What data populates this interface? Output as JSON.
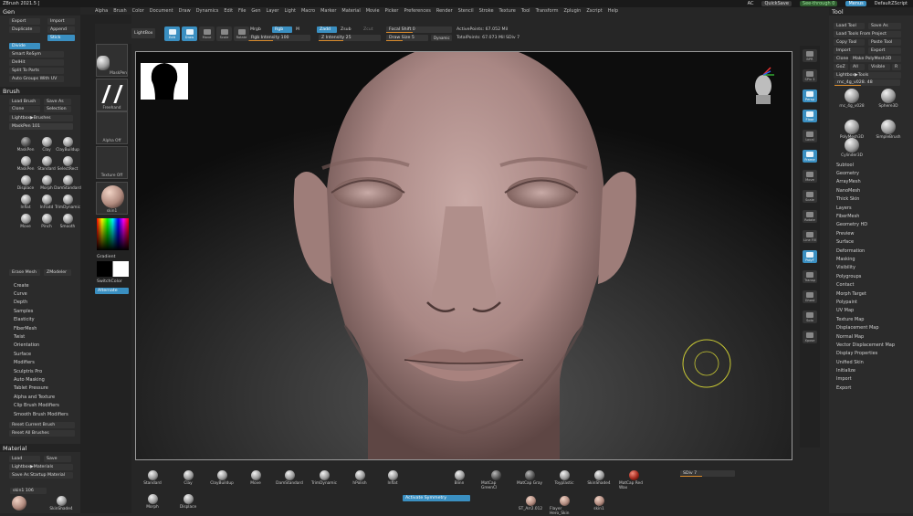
{
  "window_title": "ZBrush 2021.5 [",
  "title_right": {
    "ac": "AC",
    "quicksave": "QuickSave",
    "see_through": "See-through  0",
    "menus": "Menus",
    "script": "DefaultZScript"
  },
  "menubar": [
    "Alpha",
    "Brush",
    "Color",
    "Document",
    "Draw",
    "Dynamics",
    "Edit",
    "File",
    "Gen",
    "Layer",
    "Light",
    "Macro",
    "Marker",
    "Material",
    "Movie",
    "Picker",
    "Preferences",
    "Render",
    "Stencil",
    "Stroke",
    "Texture",
    "Tool",
    "Transform",
    "Zplugin",
    "Zscript",
    "Help"
  ],
  "left": {
    "gen_header": "Gen",
    "gen_buttons": [
      "Export",
      "Import",
      "Duplicate",
      "Append",
      "Stick",
      "Divide",
      "Smart ReSym",
      "DelHit",
      "Split To Parts",
      "Auto Groups With UV"
    ],
    "brush_header": "Brush",
    "brush_buttons": [
      "Load Brush",
      "Save As",
      "Clone",
      "Selection",
      "Lightbox▶Brushes",
      "MaskPen  101"
    ],
    "brushes": [
      "MaskPen",
      "Clay",
      "ClayBuildup",
      "MaskPen",
      "Standard",
      "SelectRect",
      "Displace",
      "Morph",
      "DamStandard",
      "Inflat",
      "InFlatd",
      "TrimDynamic",
      "Move",
      "Pinch",
      "Smooth",
      "Erase Mesh",
      "ZModeler"
    ],
    "bottom_row": [
      "Erase Mesh",
      "ZModeler"
    ],
    "brush_menu": [
      "Create",
      "Curve",
      "Depth",
      "Samples",
      "Elasticity",
      "FiberMesh",
      "Twist",
      "Orientation",
      "Surface",
      "Modifiers",
      "Sculptris Pro",
      "Auto Masking",
      "Tablet Pressure",
      "Alpha and Texture",
      "Clip Brush Modifiers",
      "Smooth Brush Modifiers"
    ],
    "reset_buttons": [
      "Reset Current Brush",
      "Reset All Brushes"
    ],
    "material_header": "Material",
    "material_buttons": [
      "Load",
      "Save",
      "Lightbox▶Materials",
      "Save As Startup Material"
    ],
    "material_name": "skin1  106",
    "material_thumbs": [
      "",
      "SkinShade4"
    ]
  },
  "shelf": {
    "projection_master": "Projection Master",
    "lightbox": "LightBox",
    "items": [
      "MaskPen",
      "Freehand",
      "Alpha Off",
      "Texture Off",
      "skin1"
    ],
    "gradient": "Gradient",
    "switch_color": "SwitchColor",
    "alternate": "Alternate"
  },
  "topbar": {
    "modes": [
      "Edit",
      "Draw",
      "Move",
      "Scale",
      "Rotate"
    ],
    "mrgb": "Mrgb",
    "rgb": "Rgb",
    "m": "M",
    "rgb_intensity": "Rgb Intensity  100",
    "zadd": "Zadd",
    "zsub": "Zsub",
    "zcut": "Zcut",
    "z_intensity": "Z Intensity  25",
    "focal_shift": "Focal Shift  0",
    "draw_size": "Draw Size  5",
    "dynamic": "Dynamic",
    "active_points": "ActivePoints: 67.052 Mil",
    "total_points": "TotalPoints: 67.073 Mil",
    "divide": "SDiv 7",
    "nav": "MENU"
  },
  "right_tool_strip": [
    "BPR",
    "SPix 3",
    "Persp",
    "Floor",
    "Local",
    "Frame",
    "Move",
    "Scale",
    "Rotate",
    "Line Fill",
    "PolyF",
    "Transp",
    "Ghost",
    "Solo",
    "Xpose"
  ],
  "tool": {
    "header": "Tool",
    "buttons": [
      "Load Tool",
      "Save As",
      "Load Tools From Project",
      "Copy Tool",
      "Paste Tool",
      "Import",
      "Export",
      "Clone",
      "Make PolyMesh3D",
      "GoZ",
      "All",
      "Visible",
      "R",
      "Lightbox▶Tools"
    ],
    "current": "rnc_4g_v028. 48",
    "subtools": [
      "rnc_4g_v028",
      "Sphere3D",
      "PolyMesh3D",
      "SimpleBrush",
      "Cylinder3D",
      "rnc_4g_v028"
    ],
    "menu": [
      "Subtool",
      "Geometry",
      "ArrayMesh",
      "NanoMesh",
      "Thick Skin",
      "Layers",
      "FiberMesh",
      "Geometry HD",
      "Preview",
      "Surface",
      "Deformation",
      "Masking",
      "Visibility",
      "Polygroups",
      "Contact",
      "Morph Target",
      "Polypaint",
      "UV Map",
      "Texture Map",
      "Displacement Map",
      "Normal Map",
      "Vector Displacement Map",
      "Display Properties",
      "Unified Skin",
      "Initialize",
      "Import",
      "Export"
    ]
  },
  "bottom": {
    "brushes": [
      "Standard",
      "Clay",
      "ClayBuildup",
      "Move",
      "DamStandard",
      "TrimDynamic",
      "hPolish",
      "Inflat",
      "Morph",
      "Displace"
    ],
    "materials": [
      "Blinn",
      "MatCap GreenCl",
      "MatCap Gray",
      "Toyplastic",
      "SkinShade4",
      "MatCap Red Wax"
    ],
    "sdiv": "SDiv  7",
    "activate_symmetry": "Activate Symmetry",
    "textures": [
      "ST_Arr2.012",
      "Flayer Hero_Skin",
      "skin1"
    ]
  },
  "colors": {
    "accent": "#3a8fc1",
    "orange": "#d88a2b",
    "panel": "#2b2b2b",
    "bg": "#262626"
  }
}
